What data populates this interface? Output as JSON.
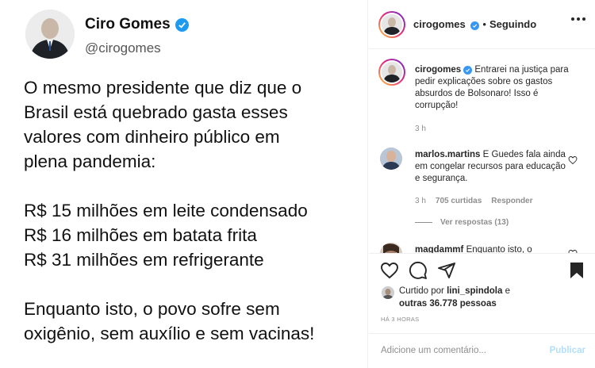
{
  "tweet": {
    "name": "Ciro Gomes",
    "handle": "@cirogomes",
    "lines": [
      "O mesmo presidente que diz que o",
      "Brasil está quebrado gasta esses",
      "valores com dinheiro público em",
      "plena pandemia:",
      "",
      "R$ 15 milhões em leite condensado",
      "R$ 16 milhões em batata frita",
      "R$ 31 milhões em refrigerante",
      "",
      "Enquanto isto, o povo sofre sem",
      "oxigênio, sem auxílio e sem vacinas!"
    ]
  },
  "header": {
    "username": "cirogomes",
    "separator": "•",
    "follow_status": "Seguindo"
  },
  "caption": {
    "username": "cirogomes",
    "text": "Entrarei na justiça para pedir explicações sobre os gastos absurdos de Bolsonaro! Isso é corrupção!",
    "time": "3 h"
  },
  "comments": [
    {
      "username": "marlos.martins",
      "text": "E Guedes fala ainda em congelar recursos para educação e segurança.",
      "time": "3 h",
      "likes": "705 curtidas",
      "reply": "Responder",
      "view_replies": "Ver respostas (13)"
    },
    {
      "username": "magdammf",
      "text": "Enquanto isto, o"
    }
  ],
  "likes": {
    "prefix": "Curtido por",
    "user": "lini_spindola",
    "connector": "e",
    "others": "outras 36.778 pessoas"
  },
  "posted": "HÁ 3 HORAS",
  "add_comment": {
    "placeholder": "Adicione um comentário...",
    "publish": "Publicar"
  },
  "colors": {
    "verified": "#3897f0",
    "publish_disabled": "#b2dffc",
    "secondary_text": "#8e8e8e"
  }
}
